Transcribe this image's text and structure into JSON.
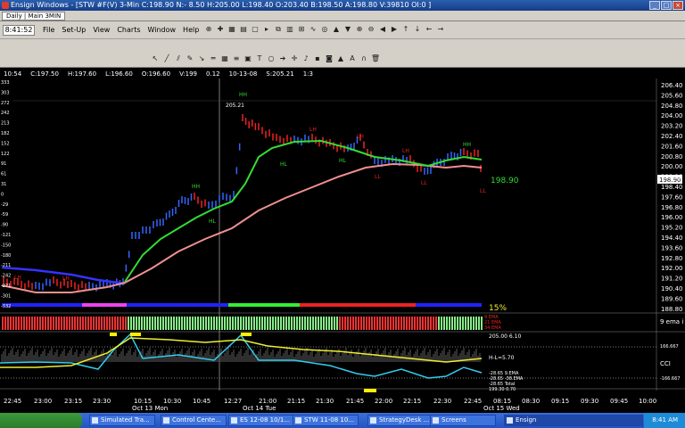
{
  "window": {
    "title": "Ensign Windows - [STW #F(V) 3-Min C:198.90 N:- 8.50 H:205.00 L:198.40 O:203.40 B:198.50 A:198.80 V:39810 OI:0 ]",
    "tab_label": "Daily | Main 3MIN"
  },
  "menubar": {
    "clock": "8:41:52",
    "items": [
      "File",
      "Set-Up",
      "View",
      "Charts",
      "Window",
      "Help"
    ]
  },
  "statusline": {
    "time": "10:54",
    "close": "C:197.50",
    "high": "H:197.60",
    "low": "L:196.60",
    "open": "O:196.60",
    "volume": "V:199",
    "v1": "0.12",
    "v2": "10-13-08",
    "s": "S:205.21",
    "v3": "1:3"
  },
  "price_axis": {
    "labels": [
      "206.40",
      "205.60",
      "204.80",
      "204.00",
      "203.20",
      "202.40",
      "201.60",
      "200.80",
      "200.00",
      "199.20",
      "198.40",
      "197.60",
      "196.80",
      "196.00",
      "195.20",
      "194.40",
      "193.60",
      "192.80",
      "192.00",
      "191.20",
      "190.40",
      "189.60",
      "188.80"
    ],
    "current": "198.90"
  },
  "left_axis": {
    "labels": [
      "333",
      "303",
      "272",
      "242",
      "213",
      "182",
      "152",
      "122",
      "91",
      "61",
      "31",
      "0",
      "-29",
      "-59",
      "-90",
      "-121",
      "-150",
      "-180",
      "-211",
      "-242",
      "-271",
      "-301",
      "-332"
    ]
  },
  "annotations": {
    "peak": "205.21",
    "last_price": "198.90",
    "pct": "15%",
    "ema_label": "9 ema i",
    "cci_label": "CCI",
    "cci_high": "166.667",
    "cci_low": "-166.667",
    "hl_label": "H-L=5.70",
    "osc_value": "205.00 6.10",
    "osc_lines": [
      "-28.65  9.EMA",
      "-28.65 -38.EMA",
      "-28.65 Total",
      "199.30 0.70"
    ],
    "mid_labels": [
      "9 EMA",
      "21 EMA",
      "34 EMA"
    ],
    "markers": [
      "HH",
      "HL",
      "LH",
      "LL"
    ]
  },
  "time_axis": {
    "labels": [
      "22:45",
      "23:00",
      "23:15",
      "23:30",
      "10:15",
      "10:30",
      "10:45",
      "12:27",
      "21:00",
      "21:15",
      "21:30",
      "21:45",
      "22:00",
      "22:15",
      "22:30",
      "22:45",
      "08:15",
      "08:30",
      "09:15",
      "09:30",
      "09:45",
      "10:00"
    ],
    "dates": [
      "Oct 13 Mon",
      "Oct 14 Tue",
      "Oct 15 Wed"
    ]
  },
  "taskbar": {
    "items": [
      "Simulated Tra...",
      "Control Cente...",
      "ES 12-08  10/1...",
      "STW 11-08  10...",
      "StrategyDesk ...",
      "Screens",
      "Ensign"
    ],
    "time": "8:41 AM"
  },
  "colors": {
    "fast_ema": "#33dd33",
    "slow_ema": "#f09090",
    "blue_line": "#3333ff",
    "cci": "#33ccee",
    "cci_signal": "#eeee33",
    "highlight": "#ffee00",
    "up_price": "#3366ff",
    "down_price": "#ee2222"
  }
}
